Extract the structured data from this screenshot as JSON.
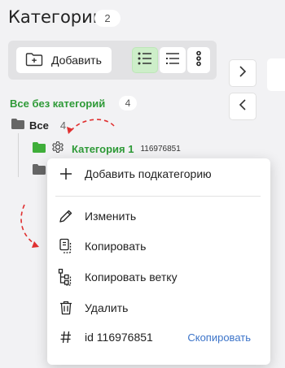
{
  "header": {
    "title": "Категории",
    "count": "2"
  },
  "toolbar": {
    "add_label": "Добавить",
    "active_view": "list"
  },
  "tree": {
    "no_category_label": "Все без категорий",
    "no_category_count": "4",
    "all_label": "Все",
    "all_count": "4",
    "category_name": "Категория 1",
    "category_id": "116976851"
  },
  "context_menu": {
    "add_subcategory": "Добавить подкатегорию",
    "edit": "Изменить",
    "copy": "Копировать",
    "copy_branch": "Копировать ветку",
    "delete": "Удалить",
    "id_label": "id 116976851",
    "copy_id_link": "Скопировать"
  },
  "colors": {
    "accent_green": "#2e9a37",
    "link_blue": "#3c74c9",
    "annotation_red": "#e03030",
    "active_view_bg": "#cdeec9"
  },
  "icons": [
    "folder-add-icon",
    "list-view-icon",
    "tree-view-icon",
    "more-vertical-icon",
    "chevron-right-icon",
    "chevron-left-icon",
    "folder-icon",
    "gear-icon",
    "plus-icon",
    "pencil-icon",
    "copy-icon",
    "copy-branch-icon",
    "trash-icon",
    "hash-icon"
  ]
}
